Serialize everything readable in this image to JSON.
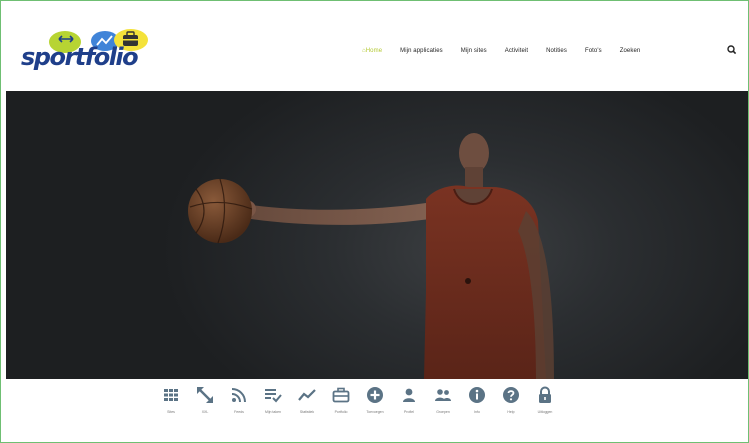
{
  "brand": {
    "name": "sportfolio",
    "colors": {
      "blue": "#1f6fd1",
      "green": "#b7d433",
      "yellow": "#f4e23a",
      "purple": "#7a3fa0"
    }
  },
  "nav": {
    "items": [
      {
        "label": "Home",
        "active": true
      },
      {
        "label": "Mijn applicaties",
        "active": false
      },
      {
        "label": "Mijn sites",
        "active": false
      },
      {
        "label": "Activiteit",
        "active": false
      },
      {
        "label": "Notities",
        "active": false
      },
      {
        "label": "Foto's",
        "active": false
      },
      {
        "label": "Zoeken",
        "active": false
      }
    ],
    "accent": "#b4c933"
  },
  "icon_bar": {
    "color": "#5b7385",
    "items": [
      {
        "icon": "grid-icon",
        "label": "Sites"
      },
      {
        "icon": "expand-arrows-icon",
        "label": "XXL"
      },
      {
        "icon": "rss-icon",
        "label": "Feeds"
      },
      {
        "icon": "checklist-icon",
        "label": "Mijn taken"
      },
      {
        "icon": "trend-line-icon",
        "label": "Statistiek"
      },
      {
        "icon": "briefcase-icon",
        "label": "Portfolio"
      },
      {
        "icon": "plus-circle-icon",
        "label": "Toevoegen"
      },
      {
        "icon": "user-icon",
        "label": "Profiel"
      },
      {
        "icon": "users-icon",
        "label": "Groepen"
      },
      {
        "icon": "info-icon",
        "label": "Info"
      },
      {
        "icon": "help-icon",
        "label": "Help"
      },
      {
        "icon": "lock-icon",
        "label": "Uitloggen"
      }
    ]
  }
}
